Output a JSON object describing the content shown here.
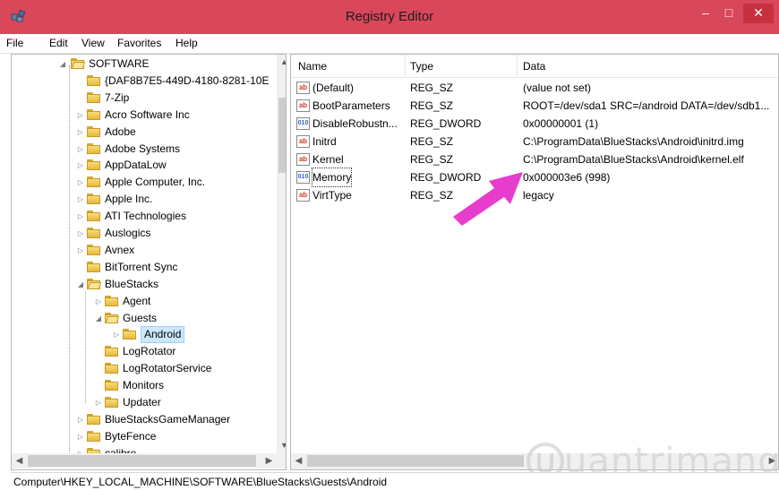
{
  "window": {
    "title": "Registry Editor",
    "min_glyph": "–",
    "max_glyph": "□",
    "close_glyph": "✕"
  },
  "menu": [
    "File",
    "Edit",
    "View",
    "Favorites",
    "Help"
  ],
  "tree": {
    "items": [
      {
        "label": "SOFTWARE",
        "indent": 0,
        "expander": "◢"
      },
      {
        "label": "{DAF8B7E5-449D-4180-8281-10E",
        "indent": 1,
        "expander": ""
      },
      {
        "label": "7-Zip",
        "indent": 1,
        "expander": ""
      },
      {
        "label": "Acro Software Inc",
        "indent": 1,
        "expander": "▷"
      },
      {
        "label": "Adobe",
        "indent": 1,
        "expander": "▷"
      },
      {
        "label": "Adobe Systems",
        "indent": 1,
        "expander": "▷"
      },
      {
        "label": "AppDataLow",
        "indent": 1,
        "expander": "▷"
      },
      {
        "label": "Apple Computer, Inc.",
        "indent": 1,
        "expander": "▷"
      },
      {
        "label": "Apple Inc.",
        "indent": 1,
        "expander": "▷"
      },
      {
        "label": "ATI Technologies",
        "indent": 1,
        "expander": "▷"
      },
      {
        "label": "Auslogics",
        "indent": 1,
        "expander": "▷"
      },
      {
        "label": "Avnex",
        "indent": 1,
        "expander": "▷"
      },
      {
        "label": "BitTorrent Sync",
        "indent": 1,
        "expander": ""
      },
      {
        "label": "BlueStacks",
        "indent": 1,
        "expander": "◢"
      },
      {
        "label": "Agent",
        "indent": 2,
        "expander": "▷"
      },
      {
        "label": "Guests",
        "indent": 2,
        "expander": "◢"
      },
      {
        "label": "Android",
        "indent": 3,
        "expander": "▷",
        "selected": true
      },
      {
        "label": "LogRotator",
        "indent": 2,
        "expander": ""
      },
      {
        "label": "LogRotatorService",
        "indent": 2,
        "expander": ""
      },
      {
        "label": "Monitors",
        "indent": 2,
        "expander": ""
      },
      {
        "label": "Updater",
        "indent": 2,
        "expander": "▷"
      },
      {
        "label": "BlueStacksGameManager",
        "indent": 1,
        "expander": "▷"
      },
      {
        "label": "ByteFence",
        "indent": 1,
        "expander": "▷"
      },
      {
        "label": "calibre",
        "indent": 1,
        "expander": "▷"
      }
    ]
  },
  "list": {
    "columns": [
      "Name",
      "Type",
      "Data"
    ],
    "rows": [
      {
        "icon": "ab",
        "name": "(Default)",
        "type": "REG_SZ",
        "data": "(value not set)"
      },
      {
        "icon": "ab",
        "name": "BootParameters",
        "type": "REG_SZ",
        "data": "ROOT=/dev/sda1 SRC=/android DATA=/dev/sdb1..."
      },
      {
        "icon": "dw",
        "name": "DisableRobustn...",
        "type": "REG_DWORD",
        "data": "0x00000001 (1)"
      },
      {
        "icon": "ab",
        "name": "Initrd",
        "type": "REG_SZ",
        "data": "C:\\ProgramData\\BlueStacks\\Android\\initrd.img"
      },
      {
        "icon": "ab",
        "name": "Kernel",
        "type": "REG_SZ",
        "data": "C:\\ProgramData\\BlueStacks\\Android\\kernel.elf"
      },
      {
        "icon": "dw",
        "name": "Memory",
        "type": "REG_DWORD",
        "data": "0x000003e6 (998)",
        "focused": true
      },
      {
        "icon": "ab",
        "name": "VirtType",
        "type": "REG_SZ",
        "data": "legacy"
      }
    ]
  },
  "status": "Computer\\HKEY_LOCAL_MACHINE\\SOFTWARE\\BlueStacks\\Guests\\Android",
  "watermark": "uantrimang",
  "icons": {
    "string_value": "ab",
    "dword_value": "010"
  },
  "colors": {
    "titlebar": "#d9475a",
    "arrow": "#e83ccd",
    "selection": "#cce8ff"
  }
}
